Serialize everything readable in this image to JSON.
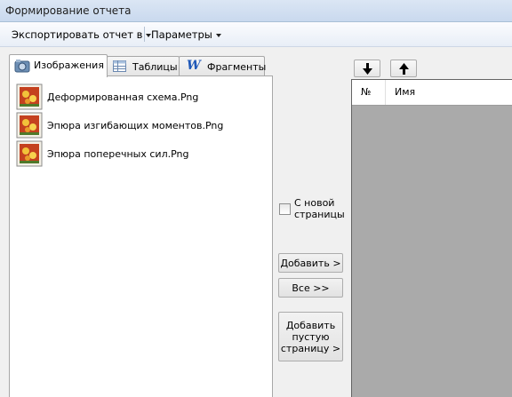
{
  "window": {
    "title": "Формирование отчета"
  },
  "menu": {
    "export_label": "Экспортировать отчет в",
    "params_label": "Параметры"
  },
  "tabs": [
    {
      "label": "Изображения",
      "icon": "images-icon",
      "active": true
    },
    {
      "label": "Таблицы",
      "icon": "table-icon",
      "active": false
    },
    {
      "label": "Фрагменты",
      "icon": "word-icon",
      "active": false
    }
  ],
  "files": [
    {
      "name": "Деформированная схема.Png",
      "icon": "image-file-icon"
    },
    {
      "name": "Эпюра изгибающих моментов.Png",
      "icon": "image-file-icon"
    },
    {
      "name": "Эпюра поперечных сил.Png",
      "icon": "image-file-icon"
    }
  ],
  "new_page_checkbox": {
    "label_line1": "С новой",
    "label_line2": "страницы",
    "checked": false
  },
  "buttons": {
    "add": "Добавить >",
    "all": "Все >>",
    "add_empty_line1": "Добавить",
    "add_empty_line2": "пустую",
    "add_empty_line3": "страницу >"
  },
  "grid": {
    "columns": [
      "№",
      "Имя"
    ]
  },
  "colors": {
    "grid_background": "#aaaaaa",
    "titlebar": "#d3e0f1"
  }
}
